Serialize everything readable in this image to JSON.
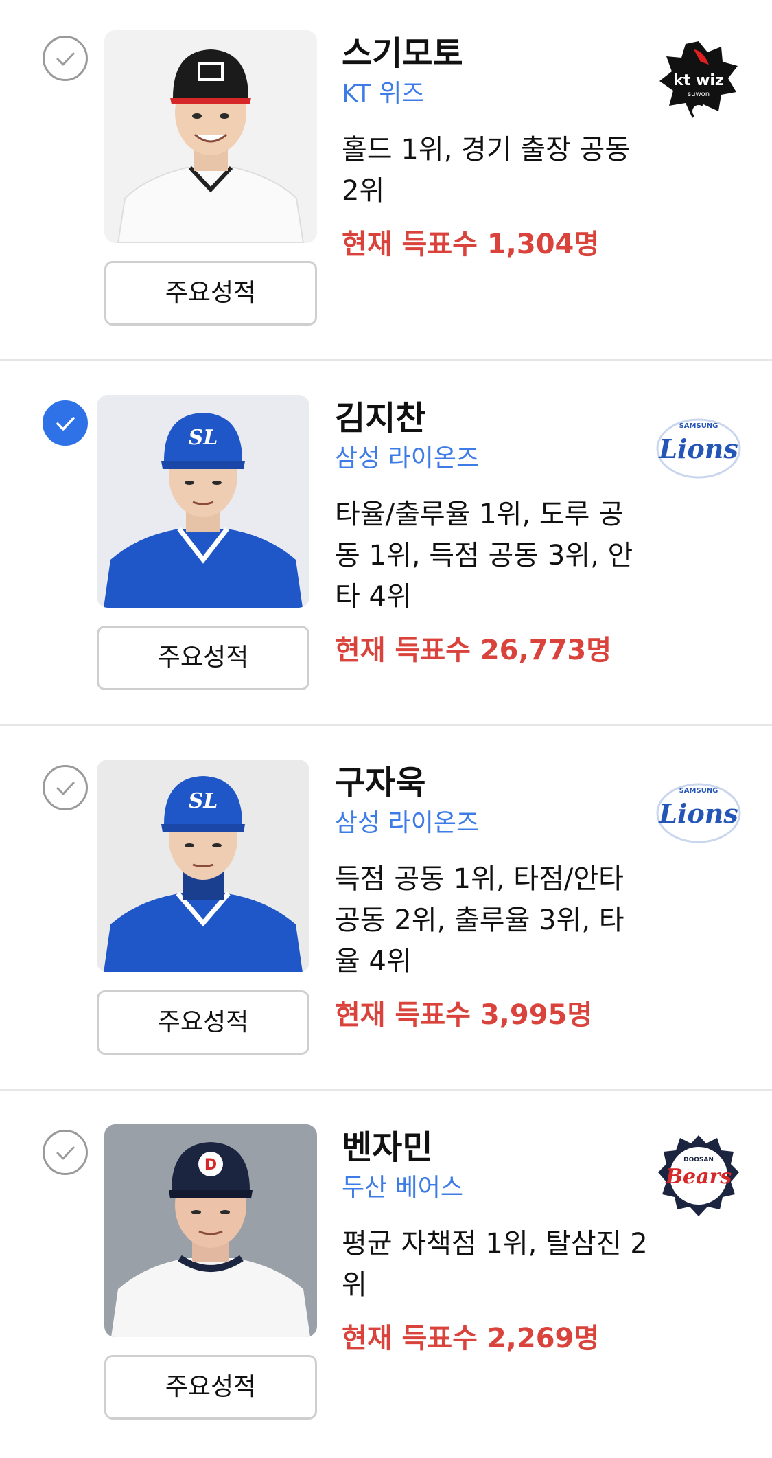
{
  "players": [
    {
      "name": "스기모토",
      "team": "KT 위즈",
      "rank_text": "홀드 1위, 경기 출장 공동 2위",
      "votes_text": "현재 득표수 1,304명",
      "button_label": "주요성적",
      "selected": false,
      "logo_text": "kt wiz",
      "logo_subtext": "suwon"
    },
    {
      "name": "김지찬",
      "team": "삼성 라이온즈",
      "rank_text": "타율/출루율 1위, 도루 공동 1위, 득점 공동 3위, 안타 4위",
      "votes_text": "현재 득표수 26,773명",
      "button_label": "주요성적",
      "selected": true,
      "logo_text": "Lions",
      "logo_subtext": "SAMSUNG"
    },
    {
      "name": "구자욱",
      "team": "삼성 라이온즈",
      "rank_text": "득점 공동 1위, 타점/안타 공동 2위, 출루율 3위, 타율 4위",
      "votes_text": "현재 득표수 3,995명",
      "button_label": "주요성적",
      "selected": false,
      "logo_text": "Lions",
      "logo_subtext": "SAMSUNG"
    },
    {
      "name": "벤자민",
      "team": "두산 베어스",
      "rank_text": "평균 자책점 1위, 탈삼진 2위",
      "votes_text": "현재 득표수 2,269명",
      "button_label": "주요성적",
      "selected": false,
      "logo_text": "Bears",
      "logo_subtext": "DOOSAN"
    }
  ],
  "colors": {
    "accent_blue": "#2f72e8",
    "team_text": "#3d7be6",
    "votes_red": "#d9433c"
  },
  "icons": {
    "checkbox": "check-icon",
    "photo": "player-photo"
  }
}
